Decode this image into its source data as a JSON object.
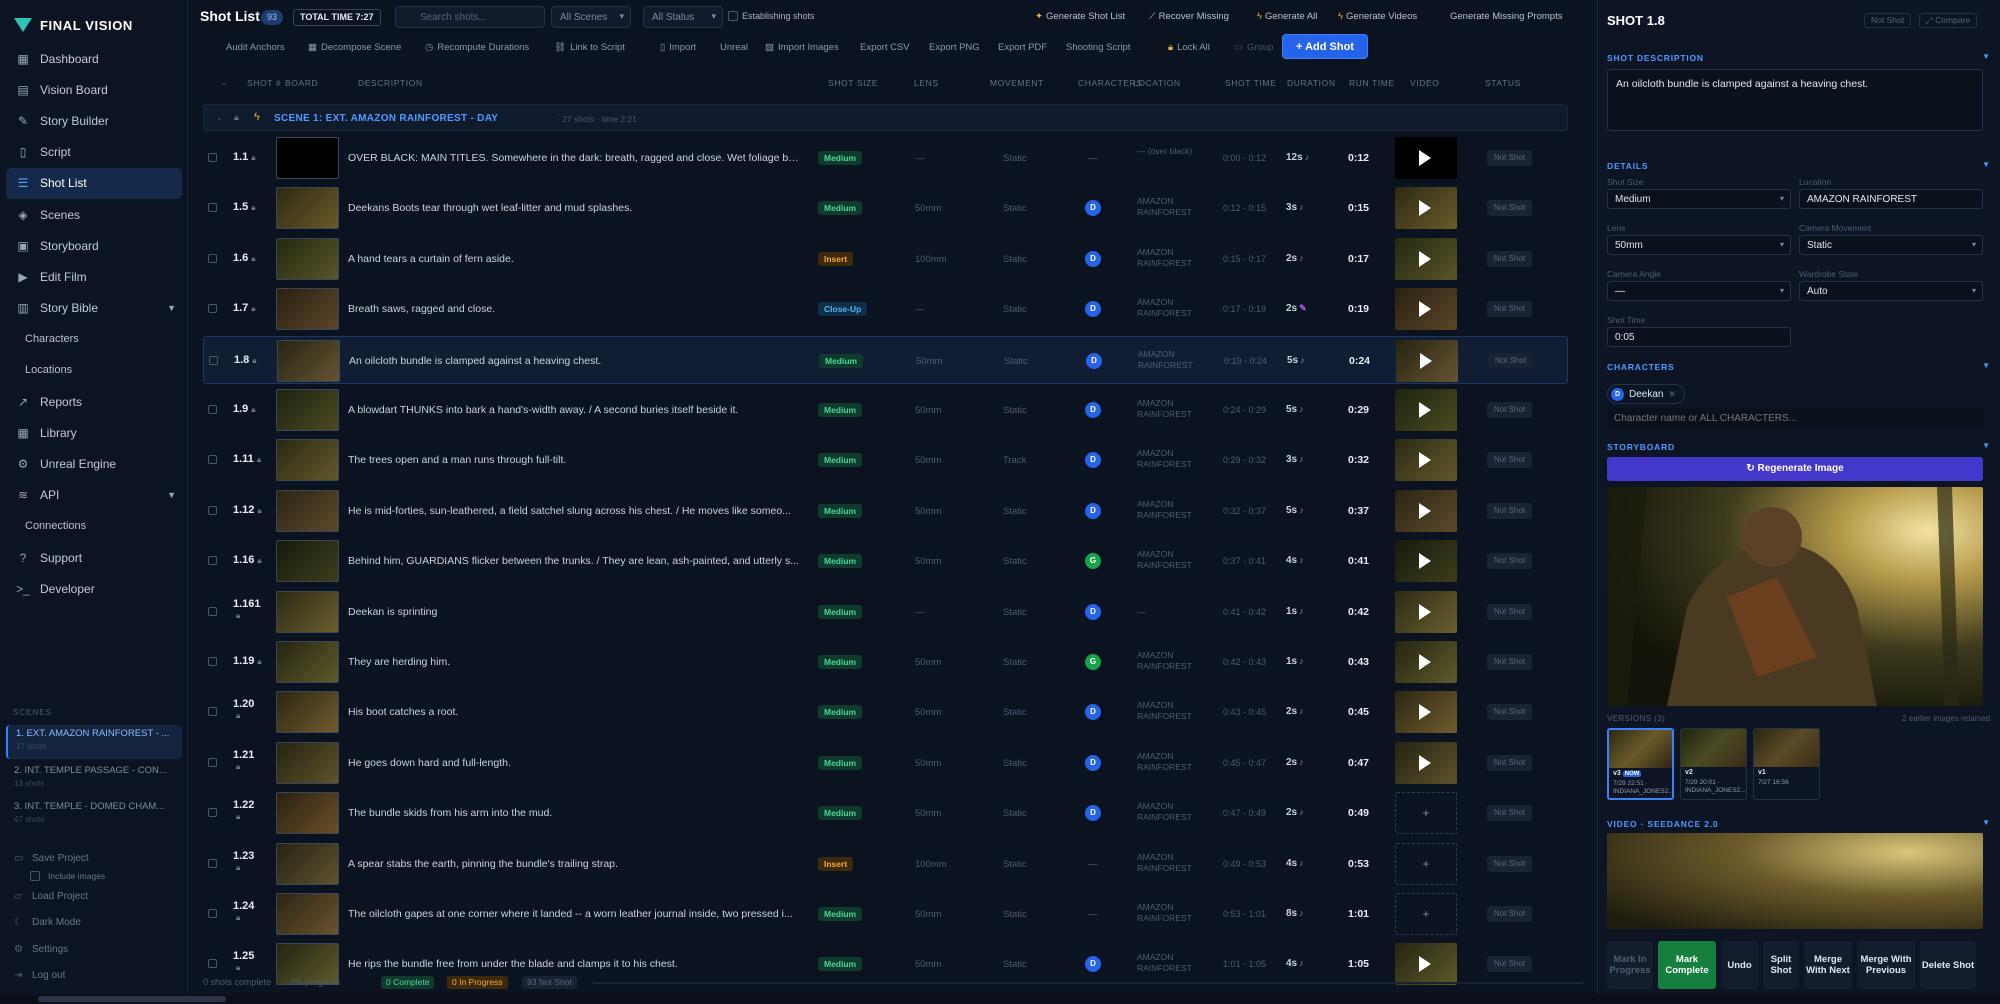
{
  "brand": {
    "name": "FINAL VISION"
  },
  "sidebar": {
    "items": [
      {
        "label": "Dashboard",
        "icon": "grid-icon"
      },
      {
        "label": "Vision Board",
        "icon": "board-icon"
      },
      {
        "label": "Story Builder",
        "icon": "pen-icon"
      },
      {
        "label": "Script",
        "icon": "document-icon"
      },
      {
        "label": "Shot List",
        "icon": "list-icon"
      },
      {
        "label": "Scenes",
        "icon": "layers-icon"
      },
      {
        "label": "Storyboard",
        "icon": "storyboard-icon"
      },
      {
        "label": "Edit Film",
        "icon": "video-icon"
      },
      {
        "label": "Story Bible",
        "icon": "book-icon"
      },
      {
        "label": "Characters"
      },
      {
        "label": "Locations"
      },
      {
        "label": "Reports",
        "icon": "chart-icon"
      },
      {
        "label": "Library",
        "icon": "library-icon"
      },
      {
        "label": "Unreal Engine",
        "icon": "engine-icon"
      },
      {
        "label": "API",
        "icon": "stack-icon"
      },
      {
        "label": "Connections"
      },
      {
        "label": "Support",
        "icon": "help-icon"
      },
      {
        "label": "Developer",
        "icon": "terminal-icon"
      }
    ],
    "scenes_label": "SCENES",
    "scenes": [
      {
        "title": "1. EXT. AMAZON RAINFOREST - ...",
        "sub": "17 shots"
      },
      {
        "title": "2. INT. TEMPLE PASSAGE - CON...",
        "sub": "13 shots"
      },
      {
        "title": "3. INT. TEMPLE - DOMED CHAM...",
        "sub": "47 shots"
      }
    ],
    "footer": {
      "save": "Save Project",
      "include_images": "Include images",
      "load": "Load Project",
      "dark": "Dark Mode",
      "settings": "Settings",
      "logout": "Log out"
    }
  },
  "topbar": {
    "title": "Shot List",
    "count": "93",
    "total_time": "TOTAL TIME 7:27",
    "search_placeholder": "Search shots...",
    "scenes_select": "All Scenes",
    "status_select": "All Status",
    "establishing": "Establishing shots",
    "links": [
      "Generate Shot List",
      "Recover Missing",
      "Generate All",
      "Generate Videos",
      "Generate Missing Prompts"
    ]
  },
  "toolbar": {
    "items": [
      "Audit Anchors",
      "Decompose Scene",
      "Recompute Durations",
      "Link to Script",
      "Import",
      "Unreal",
      "Import Images",
      "Export CSV",
      "Export PNG",
      "Export PDF",
      "Shooting Script",
      "Lock All",
      "Group"
    ],
    "add_shot": "+ Add Shot"
  },
  "table": {
    "headers": [
      "SHOT #",
      "BOARD",
      "DESCRIPTION",
      "SHOT SIZE",
      "LENS",
      "MOVEMENT",
      "CHARACTERS",
      "LOCATION",
      "SHOT TIME",
      "DURATION",
      "RUN TIME",
      "VIDEO",
      "STATUS"
    ],
    "scene": {
      "name": "SCENE 1: EXT. AMAZON RAINFOREST - DAY",
      "shots": "· 27 shots",
      "time": "· time 2:21"
    },
    "rows": [
      {
        "num": "1.1",
        "desc": "OVER BLACK: MAIN TITLES. Somewhere in the dark: breath, ragged and close. Wet foliage bre...",
        "size": "Medium",
        "size_kind": "medium",
        "lens": "—",
        "move": "Static",
        "char": "",
        "loc": "— (over black)",
        "st": "0:00 - 0:12",
        "dur": "12s",
        "note": "♪",
        "rt": "0:12",
        "video": true,
        "status": "Not Shot"
      },
      {
        "num": "1.5",
        "desc": "Deekans Boots tear through wet leaf-litter and mud splashes.",
        "size": "Medium",
        "size_kind": "medium",
        "lens": "50mm",
        "move": "Static",
        "char": "D",
        "loc": "AMAZON RAINFOREST",
        "st": "0:12 - 0:15",
        "dur": "3s",
        "note": "♪",
        "rt": "0:15",
        "video": true,
        "status": "Not Shot"
      },
      {
        "num": "1.6",
        "desc": "A hand tears a curtain of fern aside.",
        "size": "Insert",
        "size_kind": "insert",
        "lens": "100mm",
        "move": "Static",
        "char": "D",
        "loc": "AMAZON RAINFOREST",
        "st": "0:15 - 0:17",
        "dur": "2s",
        "note": "♪",
        "rt": "0:17",
        "video": true,
        "status": "Not Shot"
      },
      {
        "num": "1.7",
        "desc": "Breath saws, ragged and close.",
        "size": "Close-Up",
        "size_kind": "closeup",
        "lens": "—",
        "move": "Static",
        "char": "D",
        "loc": "AMAZON RAINFOREST",
        "st": "0:17 - 0:19",
        "dur": "2s",
        "note": "✎",
        "rt": "0:19",
        "video": true,
        "status": "Not Shot"
      },
      {
        "num": "1.8",
        "desc": "An oilcloth bundle is clamped against a heaving chest.",
        "size": "Medium",
        "size_kind": "medium",
        "lens": "50mm",
        "move": "Static",
        "char": "D",
        "loc": "AMAZON RAINFOREST",
        "st": "0:19 - 0:24",
        "dur": "5s",
        "note": "♪",
        "rt": "0:24",
        "video": true,
        "status": "Not Shot"
      },
      {
        "num": "1.9",
        "desc": "A blowdart THUNKS into bark a hand's-width away. / A second buries itself beside it.",
        "size": "Medium",
        "size_kind": "medium",
        "lens": "50mm",
        "move": "Static",
        "char": "D",
        "loc": "AMAZON RAINFOREST",
        "st": "0:24 - 0:29",
        "dur": "5s",
        "note": "♪",
        "rt": "0:29",
        "video": true,
        "status": "Not Shot"
      },
      {
        "num": "1.11",
        "desc": "The trees open and a man runs through full-tilt.",
        "size": "Medium",
        "size_kind": "medium",
        "lens": "50mm",
        "move": "Track",
        "char": "D",
        "loc": "AMAZON RAINFOREST",
        "st": "0:29 - 0:32",
        "dur": "3s",
        "note": "♪",
        "rt": "0:32",
        "video": true,
        "status": "Not Shot"
      },
      {
        "num": "1.12",
        "desc": "He is mid-forties, sun-leathered, a field satchel slung across his chest. / He moves like someo...",
        "size": "Medium",
        "size_kind": "medium",
        "lens": "50mm",
        "move": "Static",
        "char": "D",
        "loc": "AMAZON RAINFOREST",
        "st": "0:32 - 0:37",
        "dur": "5s",
        "note": "♪",
        "rt": "0:37",
        "video": true,
        "status": "Not Shot"
      },
      {
        "num": "1.16",
        "desc": "Behind him, GUARDIANS flicker between the trunks. / They are lean, ash-painted, and utterly s...",
        "size": "Medium",
        "size_kind": "medium",
        "lens": "50mm",
        "move": "Static",
        "char": "G",
        "loc": "AMAZON RAINFOREST",
        "st": "0:37 - 0:41",
        "dur": "4s",
        "note": "♪",
        "rt": "0:41",
        "video": true,
        "status": "Not Shot"
      },
      {
        "num": "1.161",
        "desc": "Deekan is sprinting",
        "size": "Medium",
        "size_kind": "medium",
        "lens": "—",
        "move": "Static",
        "char": "D",
        "loc": "—",
        "st": "0:41 - 0:42",
        "dur": "1s",
        "note": "♪",
        "rt": "0:42",
        "video": true,
        "status": "Not Shot"
      },
      {
        "num": "1.19",
        "desc": "They are herding him.",
        "size": "Medium",
        "size_kind": "medium",
        "lens": "50mm",
        "move": "Static",
        "char": "G",
        "loc": "AMAZON RAINFOREST",
        "st": "0:42 - 0:43",
        "dur": "1s",
        "note": "♪",
        "rt": "0:43",
        "video": true,
        "status": "Not Shot"
      },
      {
        "num": "1.20",
        "desc": "His boot catches a root.",
        "size": "Medium",
        "size_kind": "medium",
        "lens": "50mm",
        "move": "Static",
        "char": "D",
        "loc": "AMAZON RAINFOREST",
        "st": "0:43 - 0:45",
        "dur": "2s",
        "note": "♪",
        "rt": "0:45",
        "video": true,
        "status": "Not Shot"
      },
      {
        "num": "1.21",
        "desc": "He goes down hard and full-length.",
        "size": "Medium",
        "size_kind": "medium",
        "lens": "50mm",
        "move": "Static",
        "char": "D",
        "loc": "AMAZON RAINFOREST",
        "st": "0:45 - 0:47",
        "dur": "2s",
        "note": "♪",
        "rt": "0:47",
        "video": true,
        "status": "Not Shot"
      },
      {
        "num": "1.22",
        "desc": "The bundle skids from his arm into the mud.",
        "size": "Medium",
        "size_kind": "medium",
        "lens": "50mm",
        "move": "Static",
        "char": "D",
        "loc": "AMAZON RAINFOREST",
        "st": "0:47 - 0:49",
        "dur": "2s",
        "note": "♪",
        "rt": "0:49",
        "video": false,
        "status": "Not Shot"
      },
      {
        "num": "1.23",
        "desc": "A spear stabs the earth, pinning the bundle's trailing strap.",
        "size": "Insert",
        "size_kind": "insert",
        "lens": "100mm",
        "move": "Static",
        "char": "",
        "loc": "AMAZON RAINFOREST",
        "st": "0:49 - 0:53",
        "dur": "4s",
        "note": "♪",
        "rt": "0:53",
        "video": false,
        "status": "Not Shot"
      },
      {
        "num": "1.24",
        "desc": "The oilcloth gapes at one corner where it landed -- a worn leather journal inside, two pressed i...",
        "size": "Medium",
        "size_kind": "medium",
        "lens": "50mm",
        "move": "Static",
        "char": "",
        "loc": "AMAZON RAINFOREST",
        "st": "0:53 - 1:01",
        "dur": "8s",
        "note": "♪",
        "rt": "1:01",
        "video": false,
        "status": "Not Shot"
      },
      {
        "num": "1.25",
        "desc": "He rips the bundle free from under the blade and clamps it to his chest.",
        "size": "Medium",
        "size_kind": "medium",
        "lens": "50mm",
        "move": "Static",
        "char": "D",
        "loc": "AMAZON RAINFOREST",
        "st": "1:01 - 1:05",
        "dur": "4s",
        "note": "♪",
        "rt": "1:05",
        "video": true,
        "status": "Not Shot"
      }
    ]
  },
  "bottom": {
    "complete_text": "0 shots complete",
    "progress_text": "· 0% progress",
    "badge_complete": "0 Complete",
    "badge_progress": "0 In Progress",
    "badge_not": "93 Not Shot"
  },
  "panel": {
    "title": "SHOT 1.8",
    "status_badge": "Not Shot",
    "compare": "⤢ Compare",
    "desc_heading": "SHOT DESCRIPTION",
    "description": "An oilcloth bundle is clamped against a heaving chest.",
    "details_heading": "DETAILS",
    "fields": {
      "shot_size_label": "Shot Size",
      "shot_size": "Medium",
      "location_label": "Location",
      "location": "AMAZON RAINFOREST",
      "lens_label": "Lens",
      "lens": "50mm",
      "movement_label": "Camera Movement",
      "movement": "Static",
      "angle_label": "Camera Angle",
      "angle": "—",
      "wardrobe_label": "Wardrobe State",
      "wardrobe": "Auto",
      "time_label": "Shot Time",
      "time": "0:05"
    },
    "characters_heading": "CHARACTERS",
    "character_chip": "Deekan",
    "character_initial": "D",
    "char_placeholder": "Character name or ALL CHARACTERS...",
    "storyboard_heading": "STORYBOARD",
    "regenerate": "↻ Regenerate Image",
    "versions_label": "VERSIONS (3)",
    "versions_note": "2 earlier images retained",
    "versions": [
      {
        "name": "v3",
        "now": "NOW",
        "date": "7/29 22:51 · INDIANA_JONES2..."
      },
      {
        "name": "v2",
        "now": "",
        "date": "7/29 20:01 · INDIANA_JONES2..."
      },
      {
        "name": "v1",
        "now": "",
        "date": "7/27 16:56"
      }
    ],
    "video_heading": "VIDEO · SEEDANCE 2.0",
    "actions": [
      "Mark In Progress",
      "Mark Complete",
      "Undo",
      "Split Shot",
      "Merge With Next",
      "Merge With Previous",
      "Delete Shot"
    ]
  }
}
